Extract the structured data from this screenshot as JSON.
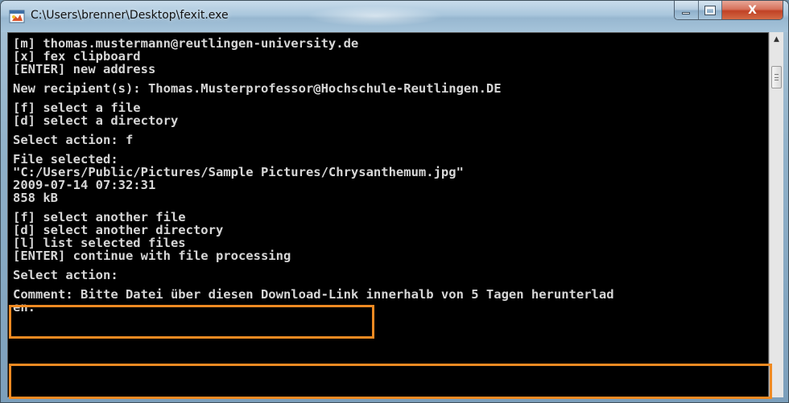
{
  "window": {
    "title": "C:\\Users\\brenner\\Desktop\\fexit.exe",
    "icon": "fexit-app-icon",
    "controls": {
      "minimize_icon": "minimize-icon",
      "maximize_icon": "maximize-icon",
      "close_glyph": "X"
    }
  },
  "console": {
    "colors": {
      "background": "#000000",
      "text": "#d7d7d7",
      "highlight": "#f08a22"
    },
    "lines": [
      "[m] thomas.mustermann@reutlingen-university.de",
      "[x] fex clipboard",
      "[ENTER] new address",
      "",
      "New recipient(s): Thomas.Musterprofessor@Hochschule-Reutlingen.DE",
      "",
      "[f] select a file",
      "[d] select a directory",
      "",
      "Select action: f",
      "",
      "File selected:",
      "\"C:/Users/Public/Pictures/Sample Pictures/Chrysanthemum.jpg\"",
      "2009-07-14 07:32:31",
      "858 kB",
      "",
      "[f] select another file",
      "[d] select another directory",
      "[l] list selected files",
      "[ENTER] continue with file processing",
      "",
      "Select action:",
      "",
      "Comment: Bitte Datei über diesen Download-Link innerhalb von 5 Tagen herunterlad",
      "en."
    ]
  },
  "scrollbar": {
    "up_arrow_icon": "scroll-up-arrow-icon"
  }
}
